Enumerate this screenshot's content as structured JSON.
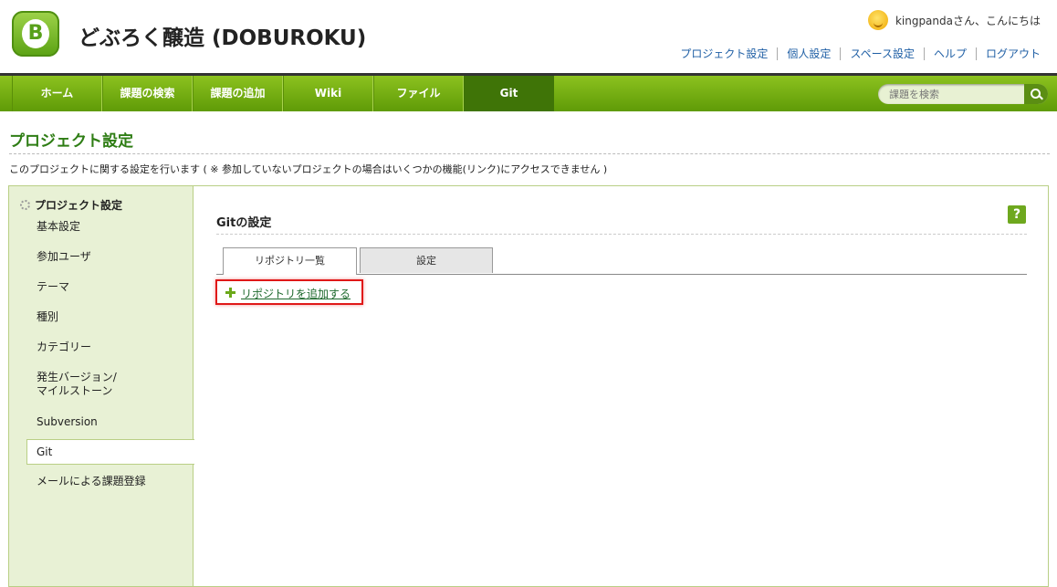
{
  "header": {
    "title": "どぶろく醸造 (DOBUROKU)",
    "greeting": "kingpandaさん、こんにちは",
    "links": [
      "プロジェクト設定",
      "個人設定",
      "スペース設定",
      "ヘルプ",
      "ログアウト"
    ]
  },
  "nav": {
    "tabs": [
      "ホーム",
      "課題の検索",
      "課題の追加",
      "Wiki",
      "ファイル",
      "Git"
    ],
    "active": "Git",
    "search_placeholder": "課題を検索"
  },
  "page": {
    "title": "プロジェクト設定",
    "description": "このプロジェクトに関する設定を行います ( ※ 参加していないプロジェクトの場合はいくつかの機能(リンク)にアクセスできません )"
  },
  "sidebar": {
    "heading": "プロジェクト設定",
    "items": [
      "基本設定",
      "参加ユーザ",
      "テーマ",
      "種別",
      "カテゴリー",
      "発生バージョン/\nマイルストーン",
      "Subversion",
      "Git",
      "メールによる課題登録"
    ],
    "active": "Git"
  },
  "main": {
    "title": "Gitの設定",
    "help": "?",
    "tabs": [
      "リポジトリ一覧",
      "設定"
    ],
    "add_link": "リポジトリを追加する"
  },
  "colors": {
    "nav_green": "#7ab317",
    "active_tab": "#3f7407",
    "title_green": "#2e7d14",
    "link_blue": "#1f5fa5",
    "highlight_red": "#e01818"
  }
}
